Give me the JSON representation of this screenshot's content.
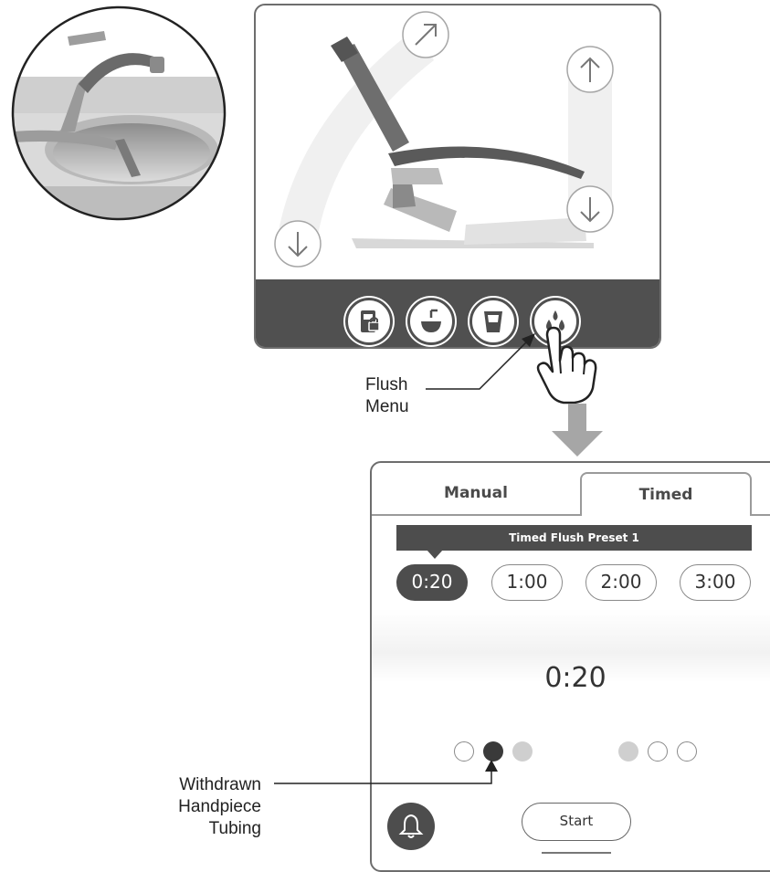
{
  "callouts": {
    "flush_menu": [
      "Flush",
      "Menu"
    ],
    "withdrawn_tubing": [
      "Withdrawn",
      "Handpiece",
      "Tubing"
    ]
  },
  "flush_screen": {
    "tabs": [
      {
        "label": "Manual",
        "selected": false
      },
      {
        "label": "Timed",
        "selected": true
      }
    ],
    "preset_label": "Timed Flush Preset 1",
    "time_options": [
      {
        "label": "0:20",
        "selected": true
      },
      {
        "label": "1:00",
        "selected": false
      },
      {
        "label": "2:00",
        "selected": false
      },
      {
        "label": "3:00",
        "selected": false
      }
    ],
    "display_time": "0:20",
    "start_label": "Start"
  },
  "chair_toolbar": {
    "icons": [
      "lock-chair-icon",
      "cuspidor-bowl-icon",
      "cup-fill-icon",
      "water-drops-icon"
    ],
    "active_icon": "water-drops-icon"
  },
  "chair_controls": [
    "up-right-arrow-icon",
    "down-arrow-icon",
    "up-arrow-icon",
    "down-arrow-icon"
  ],
  "handpiece_indicators": {
    "group_left": [
      "empty",
      "filled",
      "grey"
    ],
    "group_right": [
      "grey",
      "empty",
      "empty"
    ]
  },
  "colors": {
    "dark_gray": "#4d4d4d",
    "panel_border": "#6d6d6d",
    "arrow_gray": "#a6a6a6"
  }
}
